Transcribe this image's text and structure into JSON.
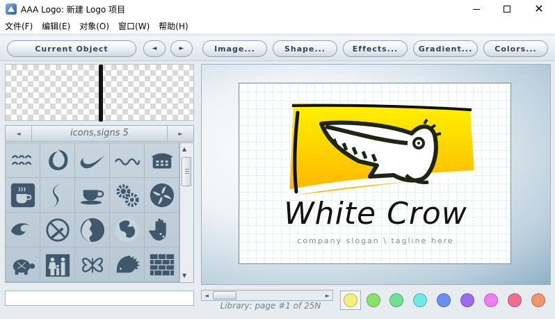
{
  "window": {
    "title": "AAA Logo: 新建 Logo 项目",
    "minimize_glyph": "—",
    "close_glyph": "✕"
  },
  "menu": [
    "文件(F)",
    "编辑(E)",
    "对象(O)",
    "窗口(W)",
    "帮助(H)"
  ],
  "toolbar": {
    "current_object": "Current Object",
    "prev_arrow": "◄",
    "next_arrow": "►",
    "image": "Image...",
    "shape": "Shape...",
    "effects": "Effects...",
    "gradient": "Gradient...",
    "colors": "Colors..."
  },
  "library": {
    "title": "icons,signs 5",
    "prev_arrow": "◄",
    "next_arrow": "►",
    "icons": [
      "wave-pattern-icon",
      "swirl-ring-icon",
      "swoosh-icon",
      "squiggle-icon",
      "telephone-icon",
      "coffee-cup-icon",
      "s-curve-icon",
      "cup-saucer-icon",
      "gears-icon",
      "pinwheel-icon",
      "wave-curl-icon",
      "no-smoking-icon",
      "globe-profile-icon",
      "world-map-icon",
      "hand-print-icon",
      "turtle-icon",
      "family-icon",
      "butterfly-icon",
      "hedgehog-icon",
      "brick-wall-icon"
    ],
    "status": "Library: page #1 of 25N"
  },
  "canvas": {
    "logo_title": "White Crow",
    "logo_slogan": "company slogan \\ tagline here"
  },
  "colors": {
    "accent_yellow": "#ffd400",
    "swatches": [
      "#f3f07a",
      "#86e46a",
      "#6fe195",
      "#6fe9e5",
      "#6b8ff0",
      "#9a6cf0",
      "#ee7ff0",
      "#ef6f93",
      "#f3956a"
    ]
  }
}
